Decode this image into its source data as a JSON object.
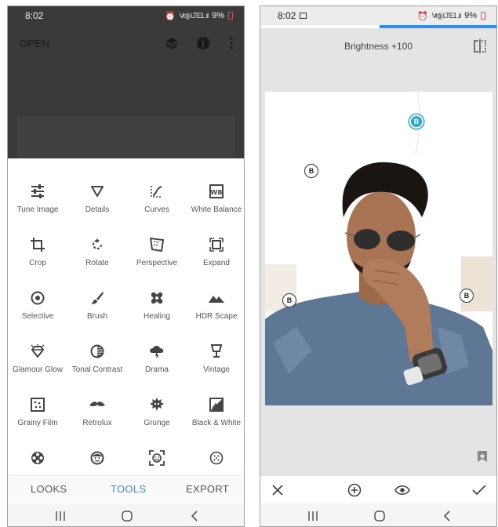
{
  "left": {
    "status": {
      "time": "8:02",
      "network": "Vo)) LTE1 .ıl",
      "battery": "9%"
    },
    "topbar": {
      "open_label": "OPEN"
    },
    "tools": [
      {
        "label": "Tune Image",
        "icon": "sliders-icon"
      },
      {
        "label": "Details",
        "icon": "triangle-icon"
      },
      {
        "label": "Curves",
        "icon": "curves-icon"
      },
      {
        "label": "White Balance",
        "icon": "wb-icon"
      },
      {
        "label": "Crop",
        "icon": "crop-icon"
      },
      {
        "label": "Rotate",
        "icon": "rotate-icon"
      },
      {
        "label": "Perspective",
        "icon": "perspective-icon"
      },
      {
        "label": "Expand",
        "icon": "expand-icon"
      },
      {
        "label": "Selective",
        "icon": "target-icon"
      },
      {
        "label": "Brush",
        "icon": "brush-icon"
      },
      {
        "label": "Healing",
        "icon": "bandage-icon"
      },
      {
        "label": "HDR Scape",
        "icon": "mountain-icon"
      },
      {
        "label": "Glamour Glow",
        "icon": "diamond-icon"
      },
      {
        "label": "Tonal Contrast",
        "icon": "contrast-icon"
      },
      {
        "label": "Drama",
        "icon": "cloud-icon"
      },
      {
        "label": "Vintage",
        "icon": "lamp-icon"
      },
      {
        "label": "Grainy Film",
        "icon": "film-grain-icon"
      },
      {
        "label": "Retrolux",
        "icon": "mustache-icon"
      },
      {
        "label": "Grunge",
        "icon": "grunge-icon"
      },
      {
        "label": "Black & White",
        "icon": "bw-icon"
      }
    ],
    "bottom_tabs": {
      "looks": "LOOKS",
      "tools": "TOOLS",
      "export": "EXPORT"
    }
  },
  "right": {
    "status": {
      "time": "8:02",
      "network": "Vo)) LTE1 .ıl",
      "battery": "9%"
    },
    "param_label": "Brightness +100",
    "pin_label": "B",
    "accent_color": "#2f8ee9"
  }
}
